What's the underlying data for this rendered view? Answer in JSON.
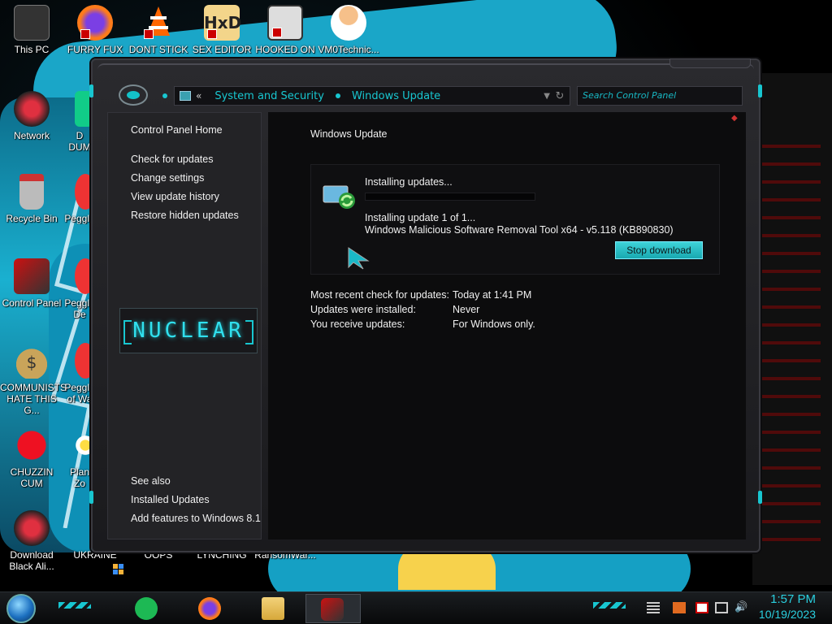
{
  "desktop_icons": [
    {
      "id": "this-pc",
      "label": "This PC"
    },
    {
      "id": "furry-fux",
      "label": "FURRY FUX"
    },
    {
      "id": "dont-stick",
      "label": "DONT STICK"
    },
    {
      "id": "sex-editor",
      "label": "SEX EDITOR"
    },
    {
      "id": "hooked-on",
      "label": "HOOKED ON"
    },
    {
      "id": "vm0technic",
      "label": "VM0Technic..."
    },
    {
      "id": "network",
      "label": "Network"
    },
    {
      "id": "d-dum",
      "label": "D\nDUM"
    },
    {
      "id": "recycle-bin",
      "label": "Recycle Bin"
    },
    {
      "id": "peggle-1",
      "label": "Peggle"
    },
    {
      "id": "control-panel",
      "label": "Control Panel"
    },
    {
      "id": "peggle-de",
      "label": "Peggle\nDe"
    },
    {
      "id": "communists",
      "label": "COMMUNISTS\nHATE THIS G..."
    },
    {
      "id": "peggle-of-wa",
      "label": "Peggle\nof Wa"
    },
    {
      "id": "chuzzin-cum",
      "label": "CHUZZIN\nCUM"
    },
    {
      "id": "plan-zo",
      "label": "Plan\nZo"
    },
    {
      "id": "download-black-ali",
      "label": "Download\nBlack Ali..."
    },
    {
      "id": "ukraine",
      "label": "UKRAINE"
    },
    {
      "id": "oops",
      "label": "OOPS"
    },
    {
      "id": "lynching",
      "label": "LYNCHING"
    },
    {
      "id": "ransomwar",
      "label": "RansomWar..."
    }
  ],
  "window": {
    "breadcrumb": [
      "System and Security",
      "Windows Update"
    ],
    "back_chevron": "«",
    "search_placeholder": "Search Control Panel",
    "left_pane": {
      "home": "Control Panel Home",
      "links": [
        "Check for updates",
        "Change settings",
        "View update history",
        "Restore hidden updates"
      ],
      "logo_text": "NUCLEAR",
      "see_also_heading": "See also",
      "see_also": [
        "Installed Updates",
        "Add features to Windows 8.1"
      ]
    },
    "content": {
      "title": "Windows Update",
      "status": "Installing updates...",
      "progress": 0,
      "detail_line1": "Installing update 1 of 1...",
      "detail_line2": "Windows Malicious Software Removal Tool x64 - v5.118 (KB890830)",
      "stop_button": "Stop download",
      "info": [
        {
          "label": "Most recent check for updates:",
          "value": "Today at 1:41 PM"
        },
        {
          "label": "Updates were installed:",
          "value": "Never"
        },
        {
          "label": "You receive updates:",
          "value": "For Windows only."
        }
      ]
    }
  },
  "taskbar": {
    "apps": [
      "spotify-icon",
      "firefox-icon",
      "file-explorer-icon",
      "control-panel-icon"
    ],
    "clock": {
      "time": "1:57 PM",
      "date": "10/19/2023"
    }
  },
  "colors": {
    "accent": "#18c6d0",
    "text": "#f0f0f0",
    "panel": "#232326"
  }
}
